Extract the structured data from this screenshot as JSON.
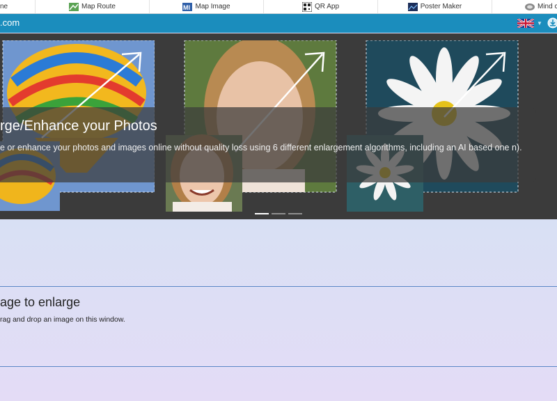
{
  "topbar": {
    "items": [
      {
        "label": "ne",
        "icon": "partial-icon"
      },
      {
        "label": "Map Route",
        "icon": "map-route-icon"
      },
      {
        "label": "Map Image",
        "icon": "map-image-icon"
      },
      {
        "label": "QR App",
        "icon": "qr-code-icon"
      },
      {
        "label": "Poster Maker",
        "icon": "poster-maker-icon"
      },
      {
        "label": "Mind cl",
        "icon": "mind-map-icon"
      }
    ]
  },
  "navbar": {
    "brand": ".com",
    "language_flag": "uk-flag-icon",
    "accent_color": "#1b8dbd"
  },
  "hero": {
    "title": "rge/Enhance your Photos",
    "description": "e or enhance your photos and images online without quality loss using 6 different enlargement algorithms, including an AI based one n).",
    "slides_count": 3,
    "active_slide": 1
  },
  "upload": {
    "title": "age to enlarge",
    "hint": "rag and drop an image on this window."
  }
}
